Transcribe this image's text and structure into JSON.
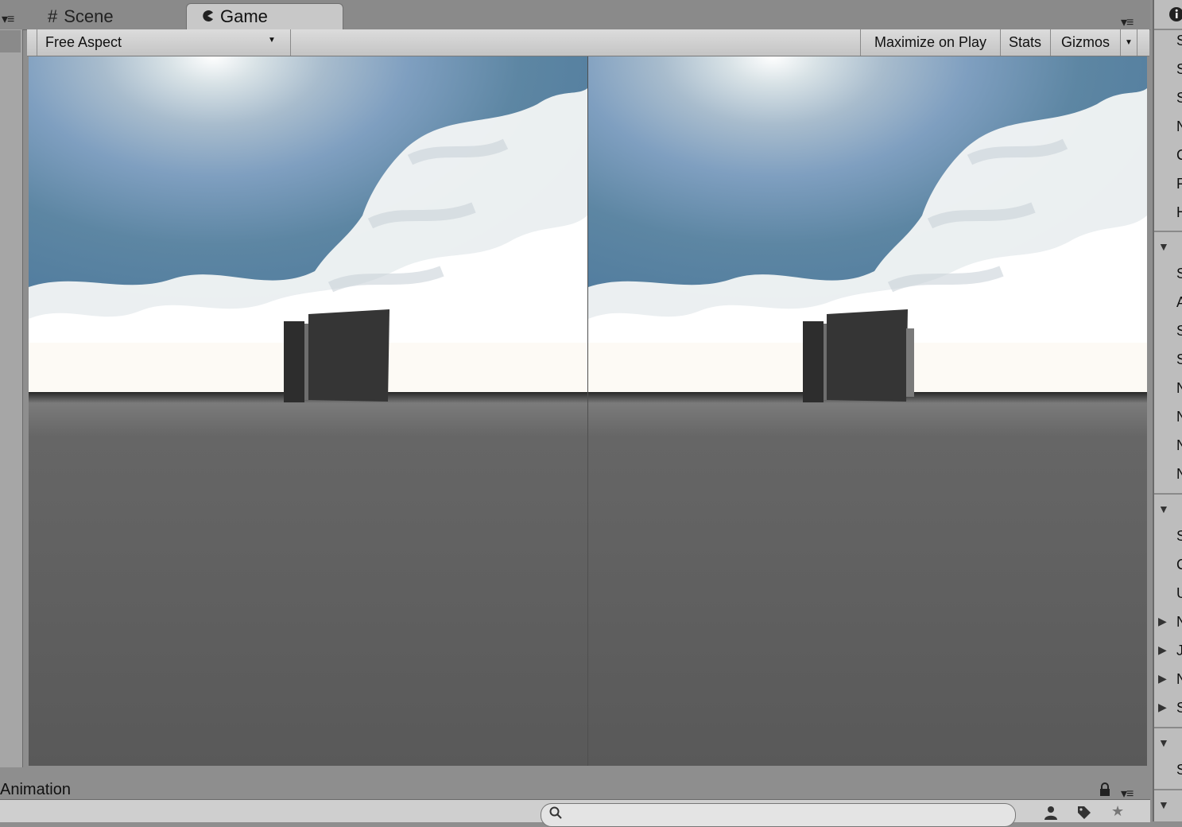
{
  "tabs": [
    {
      "label": "Scene",
      "icon": "hash-grid-icon"
    },
    {
      "label": "Game",
      "icon": "pacman-icon"
    }
  ],
  "toolbar": {
    "aspect_label": "Free Aspect",
    "maximize_label": "Maximize on Play",
    "stats_label": "Stats",
    "gizmos_label": "Gizmos"
  },
  "inspector": {
    "info_icon": "info-icon",
    "row_glyphs": [
      "S",
      "S",
      "S",
      "N",
      "C",
      "F",
      "H",
      "S",
      "A",
      "S",
      "S",
      "N",
      "N",
      "N",
      "N",
      "S",
      "C",
      "U",
      "N",
      "J",
      "N",
      "S",
      "S"
    ]
  },
  "animation_panel": {
    "title": "Animation",
    "search_placeholder": ""
  },
  "colors": {
    "sky_top": "#4f7f9f",
    "horizon": "#ffffff",
    "ground": "#5a5a5a",
    "cube": "#333333"
  }
}
